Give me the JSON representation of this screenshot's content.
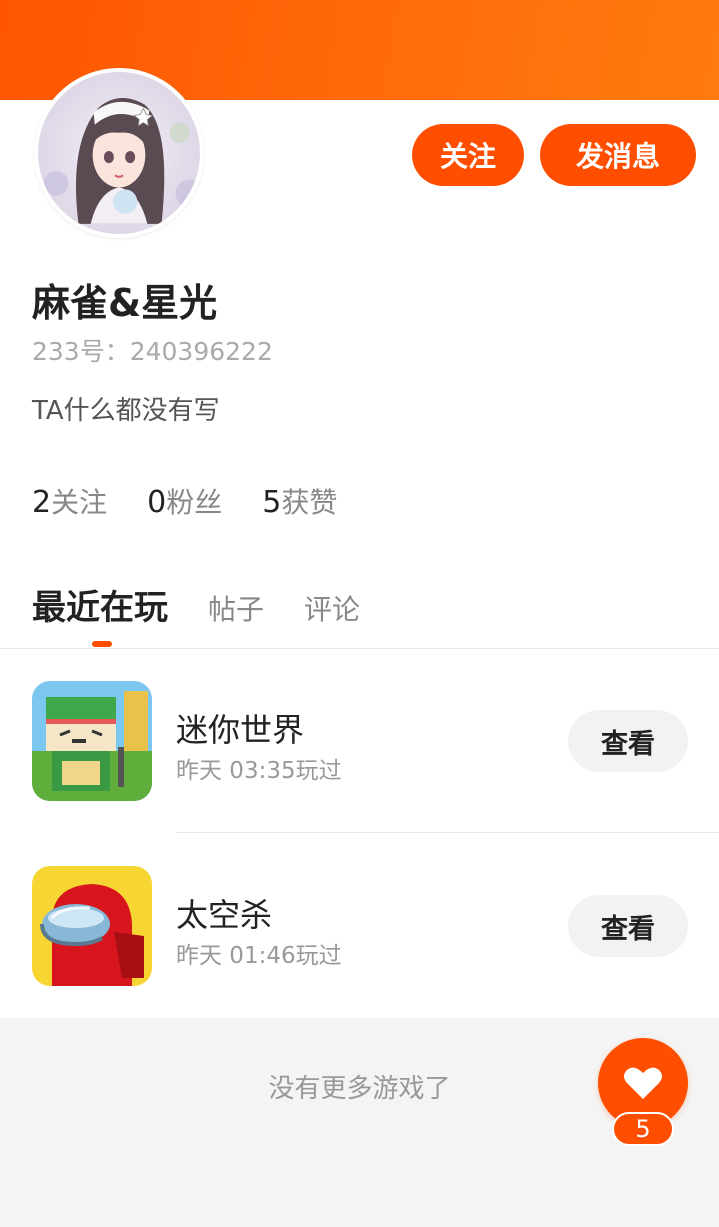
{
  "colors": {
    "accent": "#ff4e00",
    "header_gradient_end": "#ff7a10"
  },
  "profile": {
    "username": "麻雀&星光",
    "user_id": "233号：240396222",
    "bio": "TA什么都没有写",
    "avatar_icon": "anime-girl-avatar"
  },
  "actions": {
    "follow_label": "关注",
    "message_label": "发消息"
  },
  "stats": [
    {
      "value": "2",
      "label": "关注"
    },
    {
      "value": "0",
      "label": "粉丝"
    },
    {
      "value": "5",
      "label": "获赞"
    }
  ],
  "tabs": [
    {
      "label": "最近在玩",
      "active": true
    },
    {
      "label": "帖子",
      "active": false
    },
    {
      "label": "评论",
      "active": false
    }
  ],
  "games": [
    {
      "name": "迷你世界",
      "last_played": "昨天 03:35玩过",
      "button": "查看",
      "icon": "mini-world-game-icon"
    },
    {
      "name": "太空杀",
      "last_played": "昨天 01:46玩过",
      "button": "查看",
      "icon": "space-kill-game-icon"
    }
  ],
  "footer": {
    "no_more_text": "没有更多游戏了"
  },
  "like_fab": {
    "icon": "heart-icon",
    "count": "5"
  }
}
